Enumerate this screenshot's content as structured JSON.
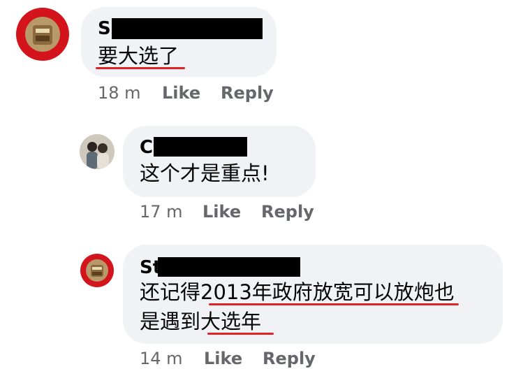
{
  "comments": [
    {
      "author_visible": "S",
      "text_lines": [
        "要大选了"
      ],
      "time": "18 m",
      "like_label": "Like",
      "reply_label": "Reply"
    },
    {
      "author_visible": "Cl",
      "text_lines": [
        "这个才是重点!"
      ],
      "time": "17 m",
      "like_label": "Like",
      "reply_label": "Reply"
    },
    {
      "author_visible": "St",
      "text_lines": [
        "还记得2013年政府放宽可以放炮也",
        "是遇到大选年"
      ],
      "time": "14 m",
      "like_label": "Like",
      "reply_label": "Reply"
    }
  ],
  "colors": {
    "bubble": "#f0f2f5",
    "meta_text": "#65676b",
    "underline": "#e02424",
    "redaction": "#000000"
  },
  "icons": [
    "red-seal-avatar",
    "couple-photo-avatar",
    "red-seal-avatar"
  ]
}
